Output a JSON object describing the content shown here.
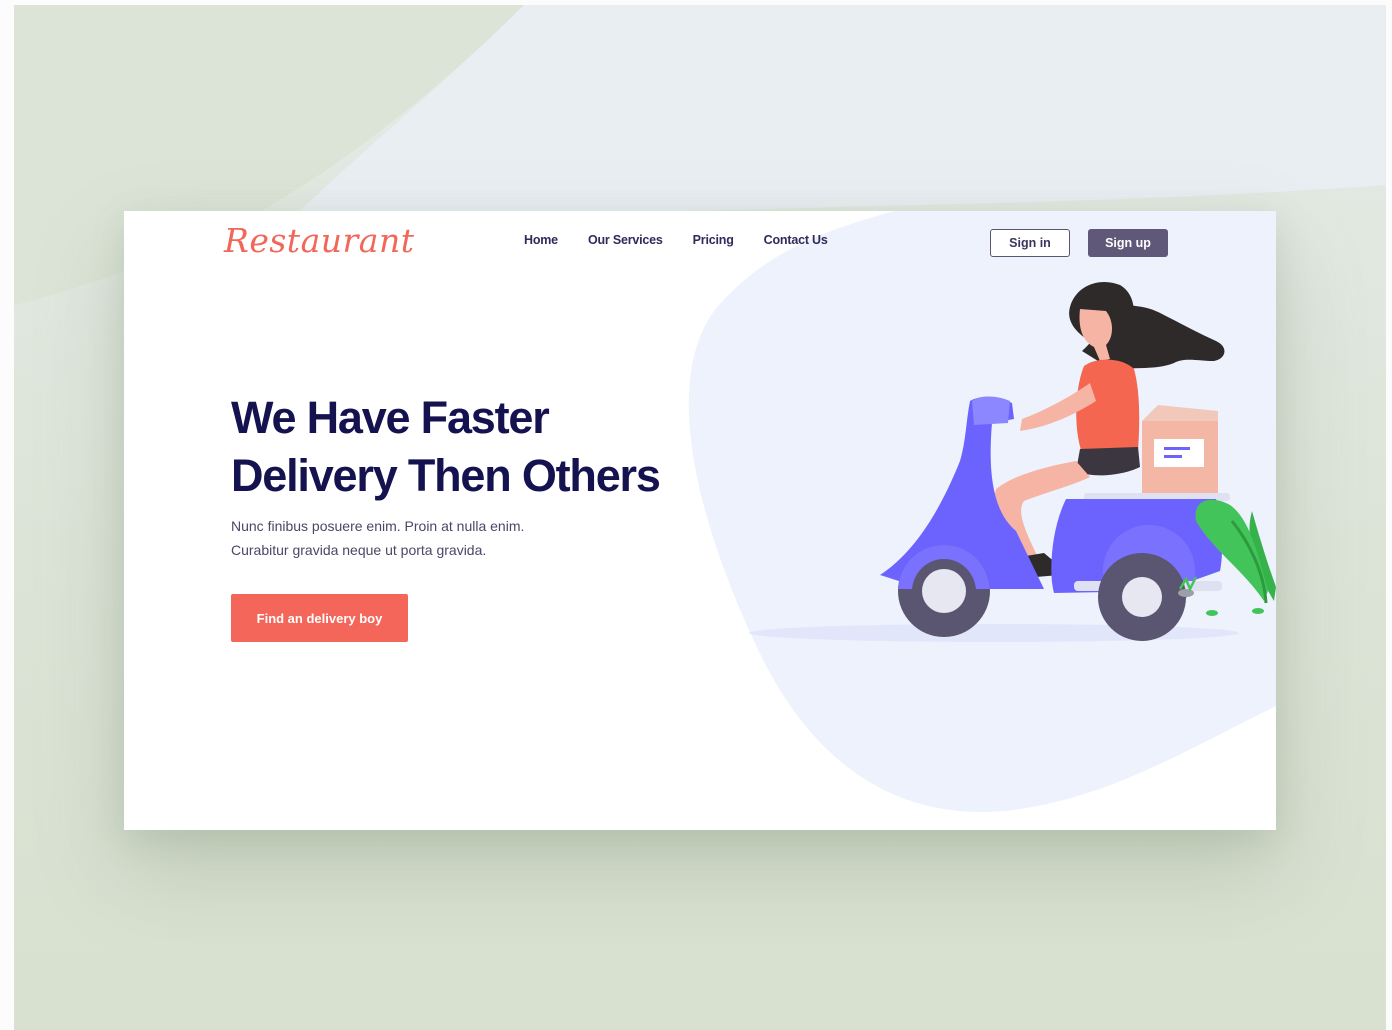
{
  "brand": {
    "logo_text": "Restaurant"
  },
  "nav": {
    "items": [
      {
        "label": "Home"
      },
      {
        "label": "Our Services"
      },
      {
        "label": "Pricing"
      },
      {
        "label": "Contact Us"
      }
    ]
  },
  "auth": {
    "signin_label": "Sign in",
    "signup_label": "Sign up"
  },
  "hero": {
    "headline_line1": "We Have Faster",
    "headline_line2": "Delivery Then Others",
    "subtext_line1": "Nunc finibus posuere enim. Proin at nulla enim.",
    "subtext_line2": "Curabitur gravida neque ut porta gravida.",
    "cta_label": "Find an delivery boy"
  },
  "colors": {
    "accent": "#f4665a",
    "headline": "#14124f",
    "signup_bg": "#5f5878",
    "scooter": "#6c63ff",
    "blob": "#eef2fd"
  },
  "icons": {
    "illustration": "delivery-scooter-illustration"
  }
}
